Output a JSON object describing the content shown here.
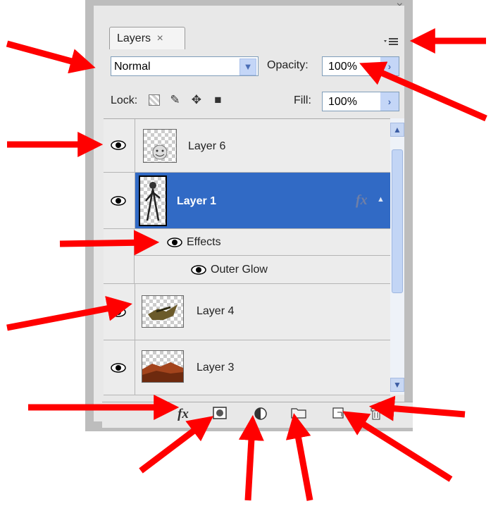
{
  "window": {
    "controls": "– ×"
  },
  "panel": {
    "tab_label": "Layers",
    "tab_close": "×",
    "menu_icon": "panel-menu-icon"
  },
  "toolbar": {
    "blend_mode": "Normal",
    "opacity_label": "Opacity:",
    "opacity_value": "100%",
    "lock_label": "Lock:",
    "fill_label": "Fill:",
    "fill_value": "100%"
  },
  "layers": [
    {
      "name": "Layer 6",
      "visible": true
    },
    {
      "name": "Layer 1",
      "visible": true,
      "selected": true,
      "fx": "fx"
    },
    {
      "name": "Effects",
      "visible": true
    },
    {
      "name": "Outer Glow",
      "visible": true
    },
    {
      "name": "Layer 4",
      "visible": true
    },
    {
      "name": "Layer 3",
      "visible": true
    }
  ],
  "bottom_bar": {
    "icons": [
      "fx-icon",
      "mask-icon",
      "adjustment-icon",
      "folder-icon",
      "new-layer-icon",
      "trash-icon"
    ],
    "fx_label": "fx"
  },
  "annotation": {
    "arrow_color": "#ff0000"
  },
  "colors": {
    "selection": "#316ac5",
    "accent": "#c4d6f7"
  }
}
